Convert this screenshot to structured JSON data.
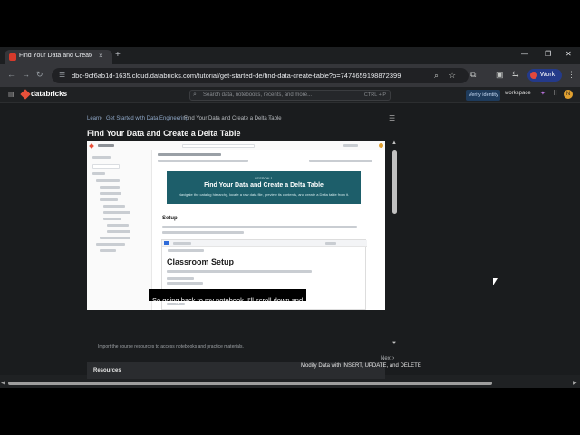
{
  "browser": {
    "tab_title": "Find Your Data and Create",
    "tab_close": "×",
    "new_tab": "+",
    "window_controls": [
      "—",
      "❐",
      "✕"
    ],
    "url": "dbc-9cf6ab1d-1635.cloud.databricks.com/tutorial/get-started-de/find-data-create-table?o=7474659198872399",
    "profile_label": "Work",
    "nav_icons": [
      "back-arrow-icon",
      "forward-arrow-icon",
      "reload-icon"
    ]
  },
  "databricks": {
    "logo": "databricks",
    "search_placeholder": "Search data, notebooks, recents, and more...",
    "search_shortcut": "CTRL + P",
    "verify_identity": "Verify identity",
    "workspace": "workspace",
    "avatar_initial": "N"
  },
  "breadcrumb": [
    "Learn",
    "Get Started with Data Engineering",
    "Find Your Data and Create a Delta Table"
  ],
  "page_title": "Find Your Data and Create a Delta Table",
  "video": {
    "lesson": "LESSON 1",
    "banner_title": "Find Your Data and Create a Delta Table",
    "banner_subtitle": "Navigate the catalog hierarchy, locate a raw data file, preview its contents, and create a Delta table from it.",
    "setup_heading": "Setup",
    "classroom_heading": "Classroom Setup",
    "caption": "So going back to my notebook, I'll scroll down and"
  },
  "resources": {
    "heading": "Resources",
    "text": "Import the course resources to access notebooks and practice materials."
  },
  "next": {
    "label": "Next",
    "title": "Modify Data with INSERT, UPDATE, and DELETE"
  },
  "colors": {
    "banner": "#1d5e6a",
    "brand": "#e9503a",
    "work_pill": "#243a8a"
  }
}
